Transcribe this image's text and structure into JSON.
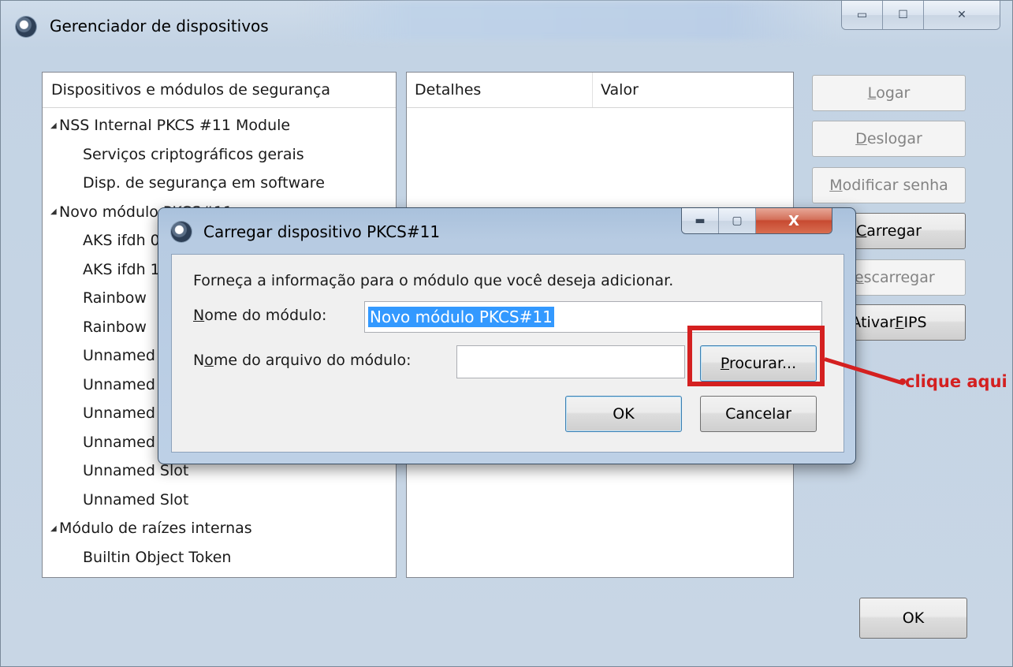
{
  "main_window": {
    "title": "Gerenciador de dispositivos",
    "caption_buttons": {
      "minimize": "▭",
      "maximize": "☐",
      "close": "✕"
    },
    "devices_panel": {
      "header": "Dispositivos e módulos de segurança",
      "tree": [
        {
          "label": "NSS Internal PKCS #11 Module",
          "level": 0,
          "expanded": true
        },
        {
          "label": "Serviços criptográficos gerais",
          "level": 1
        },
        {
          "label": "Disp. de segurança em software",
          "level": 1
        },
        {
          "label": "Novo módulo PKCS#11",
          "level": 0,
          "expanded": true
        },
        {
          "label": "AKS ifdh 0",
          "level": 1
        },
        {
          "label": "AKS ifdh 1",
          "level": 1
        },
        {
          "label": "Rainbow",
          "level": 1
        },
        {
          "label": "Rainbow",
          "level": 1
        },
        {
          "label": "Unnamed Slot",
          "level": 1
        },
        {
          "label": "Unnamed Slot",
          "level": 1
        },
        {
          "label": "Unnamed Slot",
          "level": 1
        },
        {
          "label": "Unnamed Slot",
          "level": 1
        },
        {
          "label": "Unnamed Slot",
          "level": 1
        },
        {
          "label": "Unnamed Slot",
          "level": 1
        },
        {
          "label": "Módulo de raízes internas",
          "level": 0,
          "expanded": true
        },
        {
          "label": "Builtin Object Token",
          "level": 1
        }
      ]
    },
    "details_panel": {
      "columns": [
        "Detalhes",
        "Valor"
      ]
    },
    "side_buttons": {
      "logar": {
        "pre": "",
        "key": "L",
        "post": "ogar"
      },
      "deslogar": {
        "pre": "",
        "key": "D",
        "post": "eslogar"
      },
      "modificar": {
        "pre": "",
        "key": "M",
        "post": "odificar senha"
      },
      "carregar": {
        "pre": "",
        "key": "C",
        "post": "arregar"
      },
      "descarregar": {
        "pre": "D",
        "key": "e",
        "post": "scarregar"
      },
      "fips": {
        "pre": "Ativar ",
        "key": "F",
        "post": "IPS"
      }
    },
    "ok_button": "OK"
  },
  "dialog": {
    "title": "Carregar dispositivo PKCS#11",
    "caption_buttons": {
      "minimize": "▬",
      "maximize": "▢",
      "close": "X"
    },
    "info": "Forneça a informação para o módulo que você deseja adicionar.",
    "module_name": {
      "key": "N",
      "rest": "ome do módulo:",
      "value": "Novo módulo PKCS#11"
    },
    "module_file": {
      "pre": "N",
      "key": "o",
      "rest": "me do arquivo do módulo:",
      "value": ""
    },
    "browse": {
      "key": "P",
      "rest": "rocurar..."
    },
    "ok": "OK",
    "cancel": "Cancelar"
  },
  "annotation": {
    "text": "clique aqui",
    "color": "#d42020"
  }
}
